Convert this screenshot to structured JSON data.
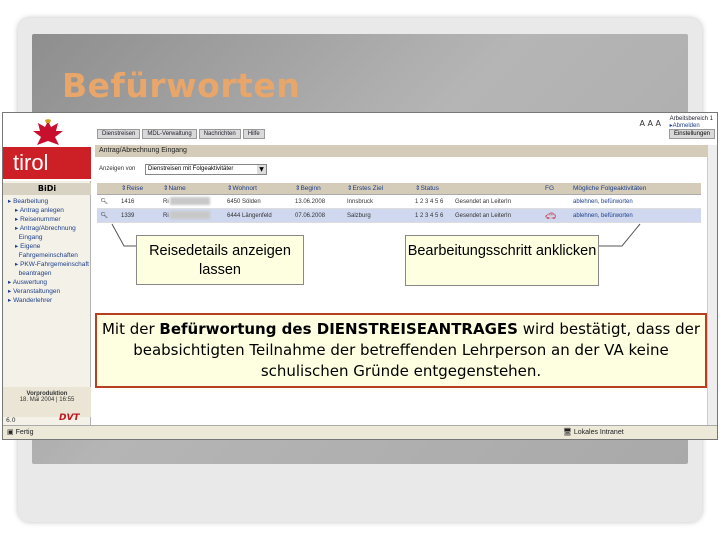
{
  "slide": {
    "title": "Befürworten"
  },
  "app": {
    "brand": "tirol",
    "module": "BiDi",
    "workarea_label": "Arbeitsbereich 1",
    "logout": "▸Abmelden",
    "font_size_glyphs": "A A A",
    "settings_button": "Einstellungen",
    "tabs": [
      "Dienstreisen",
      "MDL-Verwaltung",
      "Nachrichten",
      "Hilfe"
    ],
    "sidebar": {
      "items": [
        {
          "label": "Bearbeitung",
          "sub": false
        },
        {
          "label": "Antrag anlegen",
          "sub": true
        },
        {
          "label": "Reisenummer",
          "sub": true
        },
        {
          "label": "Antrag/Abrechnung",
          "sub": true
        },
        {
          "label": "Eingang",
          "sub": true
        },
        {
          "label": "Eigene",
          "sub": true
        },
        {
          "label": "Fahrgemeinschaften",
          "sub": true
        },
        {
          "label": "PKW-Fahrgemeinschaft",
          "sub": true
        },
        {
          "label": "beantragen",
          "sub": true
        },
        {
          "label": "Auswertung",
          "sub": false
        },
        {
          "label": "Veranstaltungen",
          "sub": false
        },
        {
          "label": "Wanderlehrer",
          "sub": false
        }
      ],
      "production_label": "Vorproduktion",
      "production_date": "18. Mai 2004 | 16:55",
      "version": "6.0",
      "vendor": "DVT"
    },
    "panel_title": "Antrag/Abrechnung Eingang",
    "filter": {
      "label": "Anzeigen von",
      "selected": "Dienstreisen mit Folgeaktivitäter"
    },
    "table": {
      "headers": [
        "",
        "Reise",
        "Name",
        "Wohnort",
        "Beginn",
        "Erstes Ziel",
        "Status",
        "",
        "FG",
        "Mögliche Folgeaktivitäten"
      ],
      "rows": [
        {
          "reise": "1416",
          "name": "Ri",
          "wohnort": "6450 Sölden",
          "beginn": "13.06.2008",
          "ziel": "Innsbruck",
          "status": "1 2 3 4 5 6",
          "status_text": "Gesendet an LeiterIn",
          "fg": "",
          "actions": "ablehnen, befürworten"
        },
        {
          "reise": "1339",
          "name": "Ri",
          "wohnort": "6444 Längenfeld",
          "beginn": "07.06.2008",
          "ziel": "Salzburg",
          "status": "1 2 3 4 5 6",
          "status_text": "Gesendet an LeiterIn",
          "fg": "car",
          "actions": "ablehnen, befürworten"
        }
      ]
    },
    "statusbar": {
      "left": "Fertig",
      "right": "Lokales Intranet"
    }
  },
  "callouts": {
    "details": "Reisedetails anzeigen lassen",
    "step": "Bearbeitungsschritt anklicken",
    "note_pre": "Mit der ",
    "note_bold": "Befürwortung des DIENSTREISEANTRAGES",
    "note_post": " wird bestätigt, dass der beabsichtigten Teilnahme der betreffenden Lehrperson an der VA keine schulischen Gründe entgegenstehen."
  },
  "colors": {
    "title": "#e8a66a",
    "tirol_red": "#cc1f26",
    "callout_bg": "#fefee0",
    "note_border": "#b74020",
    "link": "#1d3f8a"
  }
}
